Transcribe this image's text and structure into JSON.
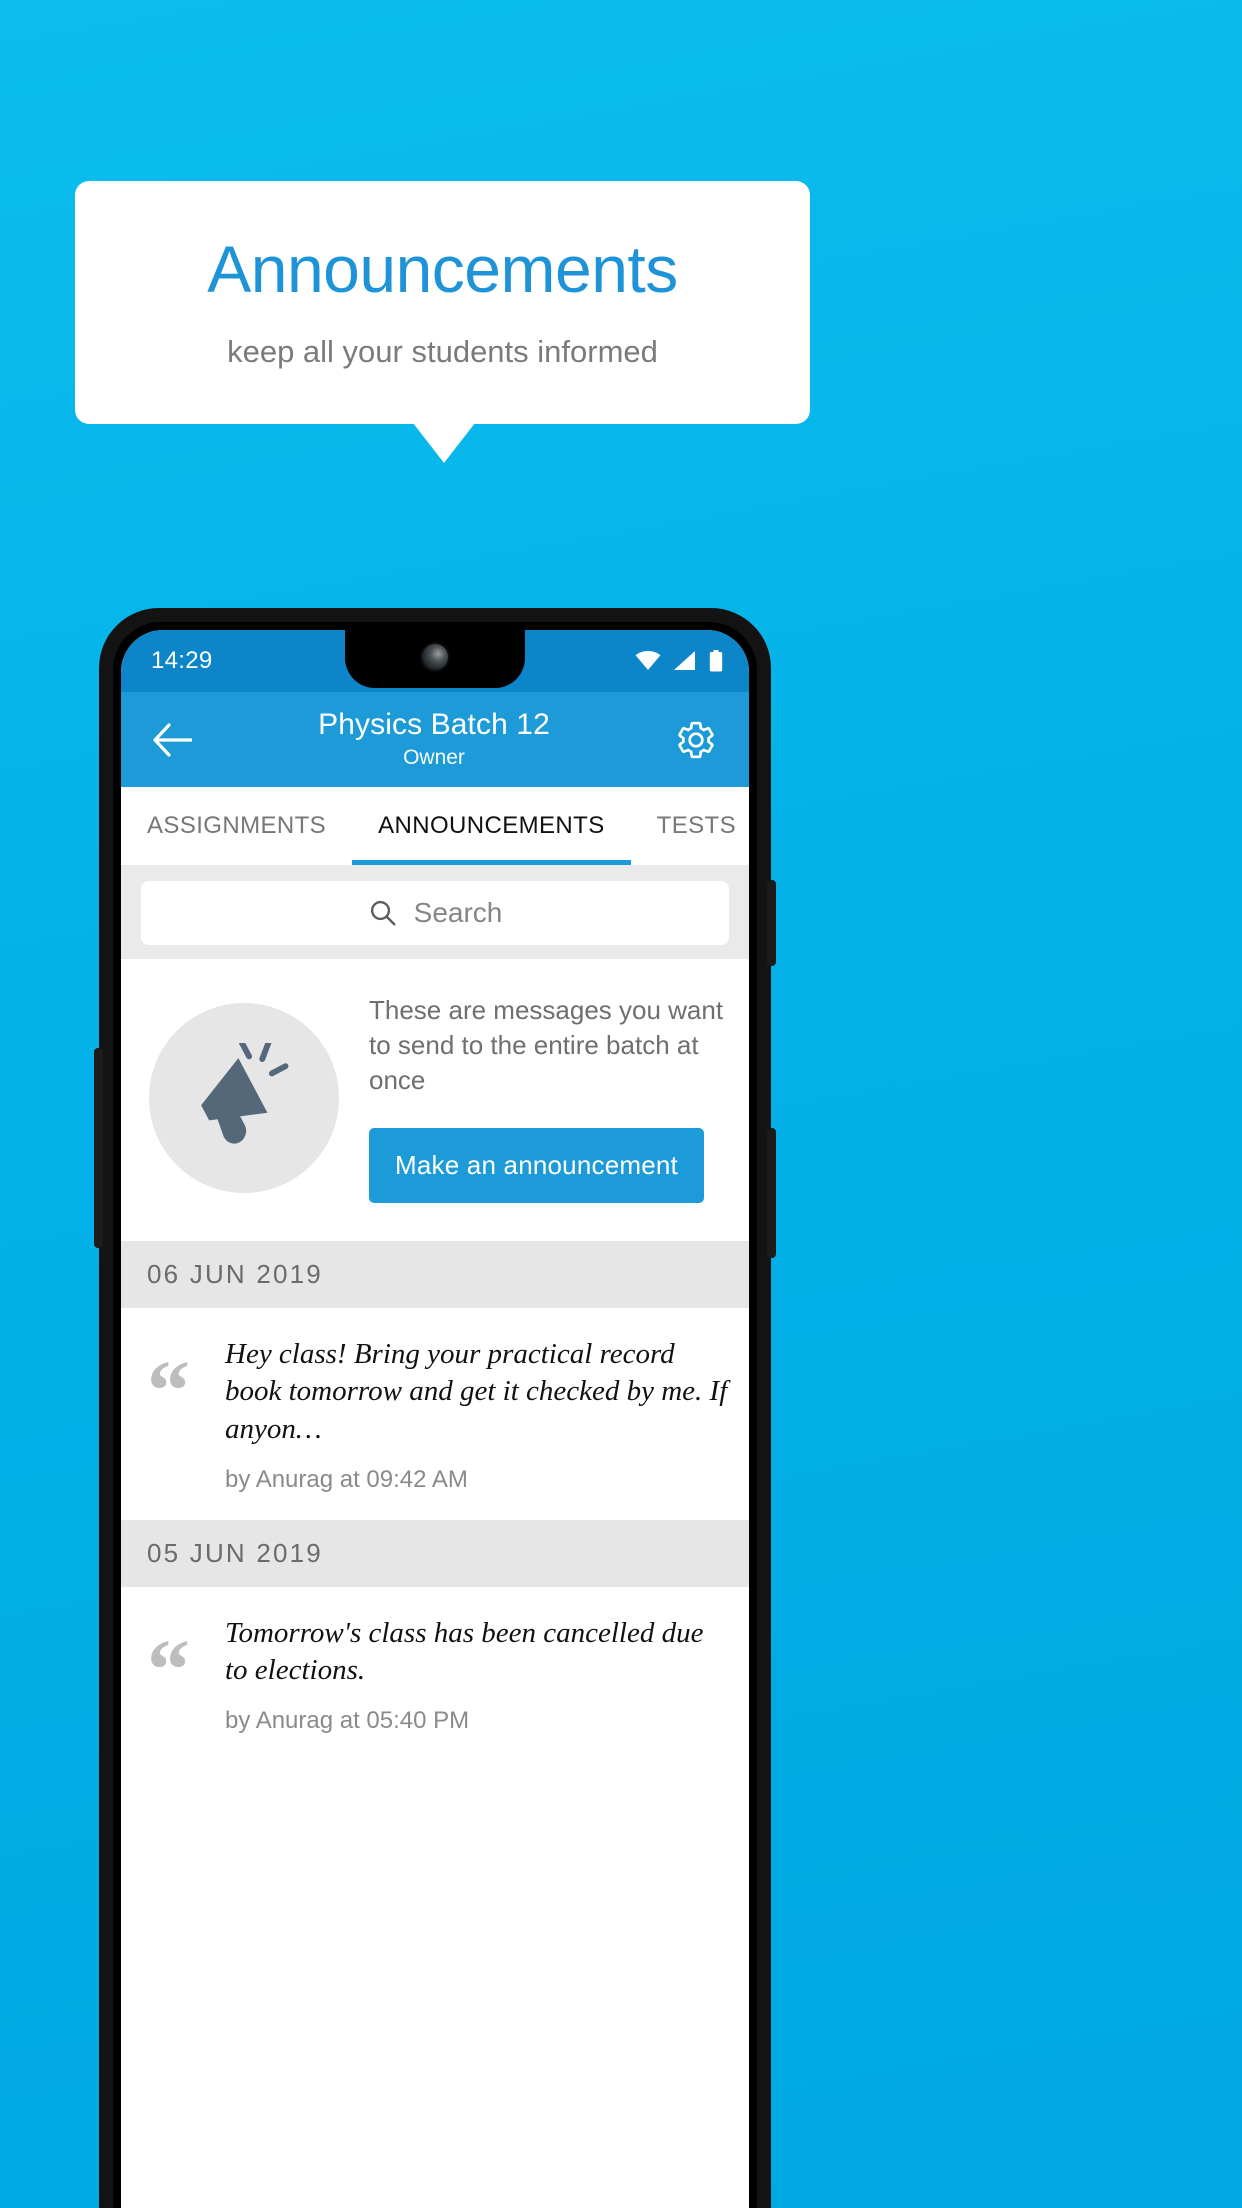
{
  "promo": {
    "title": "Announcements",
    "subtitle": "keep all your students informed",
    "accent_color": "#1f93d8",
    "background_color": "#03b1e8",
    "card_color": "#ffffff"
  },
  "phone": {
    "status_bar": {
      "time": "14:29",
      "icons": [
        "wifi-icon",
        "signal-icon",
        "battery-icon"
      ],
      "background_color": "#0d86c9"
    },
    "app_bar": {
      "back_icon": "back-arrow-icon",
      "title": "Physics Batch 12",
      "subtitle": "Owner",
      "settings_icon": "gear-icon",
      "background_color": "#1d9bd8"
    },
    "tabs": [
      {
        "label": "ASSIGNMENTS",
        "active": false
      },
      {
        "label": "ANNOUNCEMENTS",
        "active": true
      },
      {
        "label": "TESTS",
        "active": false
      },
      {
        "label": "‘",
        "active": false
      }
    ],
    "search": {
      "icon": "search-icon",
      "placeholder": "Search",
      "value": ""
    },
    "empty_state": {
      "icon": "megaphone-icon",
      "text": "These are messages you want to send to the entire batch at once",
      "button_label": "Make an announcement"
    },
    "sections": [
      {
        "date": "06  JUN  2019",
        "items": [
          {
            "quote_icon": "quote-icon",
            "text": "Hey class! Bring your practical record book tomorrow and get it checked by me. If anyon…",
            "meta": "by Anurag at 09:42 AM"
          }
        ]
      },
      {
        "date": "05  JUN  2019",
        "items": [
          {
            "quote_icon": "quote-icon",
            "text": "Tomorrow's class has been cancelled due to elections.",
            "meta": "by Anurag at 05:40 PM"
          }
        ]
      }
    ]
  }
}
